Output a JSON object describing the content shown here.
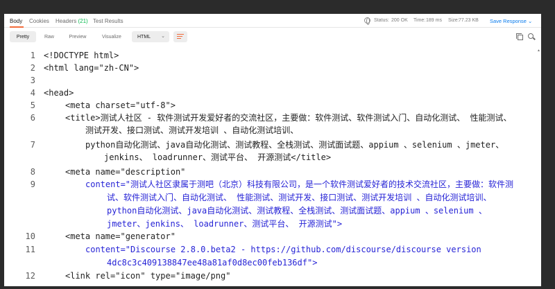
{
  "tabs": [
    {
      "label": "Body",
      "active": true
    },
    {
      "label": "Cookies",
      "active": false
    },
    {
      "label": "Headers",
      "count": "(21)",
      "active": false
    },
    {
      "label": "Test Results",
      "active": false
    }
  ],
  "status": {
    "status_label": "Status:",
    "status_value": "200 OK",
    "time_label": "Time:",
    "time_value": "189 ms",
    "size_label": "Size:",
    "size_value": "77.23 KB"
  },
  "save_response": "Save Response",
  "view_modes": [
    "Pretty",
    "Raw",
    "Preview",
    "Visualize"
  ],
  "format": "HTML",
  "lines": [
    {
      "n": "1",
      "rows": [
        "<!DOCTYPE html>"
      ]
    },
    {
      "n": "2",
      "rows": [
        "<html lang=\"zh-CN\">"
      ]
    },
    {
      "n": "3",
      "rows": [
        ""
      ]
    },
    {
      "n": "4",
      "rows": [
        "<head>"
      ]
    },
    {
      "n": "5",
      "rows": [
        "<meta charset=\"utf-8\">"
      ]
    },
    {
      "n": "6",
      "rows": [
        "<title>测试人社区 - 软件测试开发爱好者的交流社区，主要做：软件测试、软件测试入门、自动化测试、 性能测试、",
        "测试开发、接口测试、测试开发培训 、自动化测试培训、"
      ]
    },
    {
      "n": "7",
      "rows": [
        "python自动化测试、java自动化测试、测试教程、全栈测试、测试面试题、appium 、selenium 、jmeter、",
        "jenkins、 loadrunner、测试平台、 开源测试</title>"
      ]
    },
    {
      "n": "8",
      "rows": [
        "<meta name=\"description\""
      ]
    },
    {
      "n": "9",
      "rows": [
        "content=\"测试人社区隶属于测吧（北京）科技有限公司，是一个软件测试爱好者的技术交流社区，主要做：软件测",
        "试、软件测试入门、自动化测试、 性能测试、测试开发、接口测试、测试开发培训 、自动化测试培训、",
        "python自动化测试、java自动化测试、测试教程、全栈测试、测试面试题、appium 、selenium 、",
        "jmeter、jenkins、 loadrunner、测试平台、 开源测试\">"
      ]
    },
    {
      "n": "10",
      "rows": [
        "<meta name=\"generator\""
      ]
    },
    {
      "n": "11",
      "rows": [
        "content=\"Discourse 2.8.0.beta2 - https://github.com/discourse/discourse version",
        "4dc8c3c409138847ee48a81af0d8ec00feb136df\">"
      ]
    },
    {
      "n": "12",
      "rows": [
        "<link rel=\"icon\" type=\"image/png\""
      ]
    }
  ]
}
